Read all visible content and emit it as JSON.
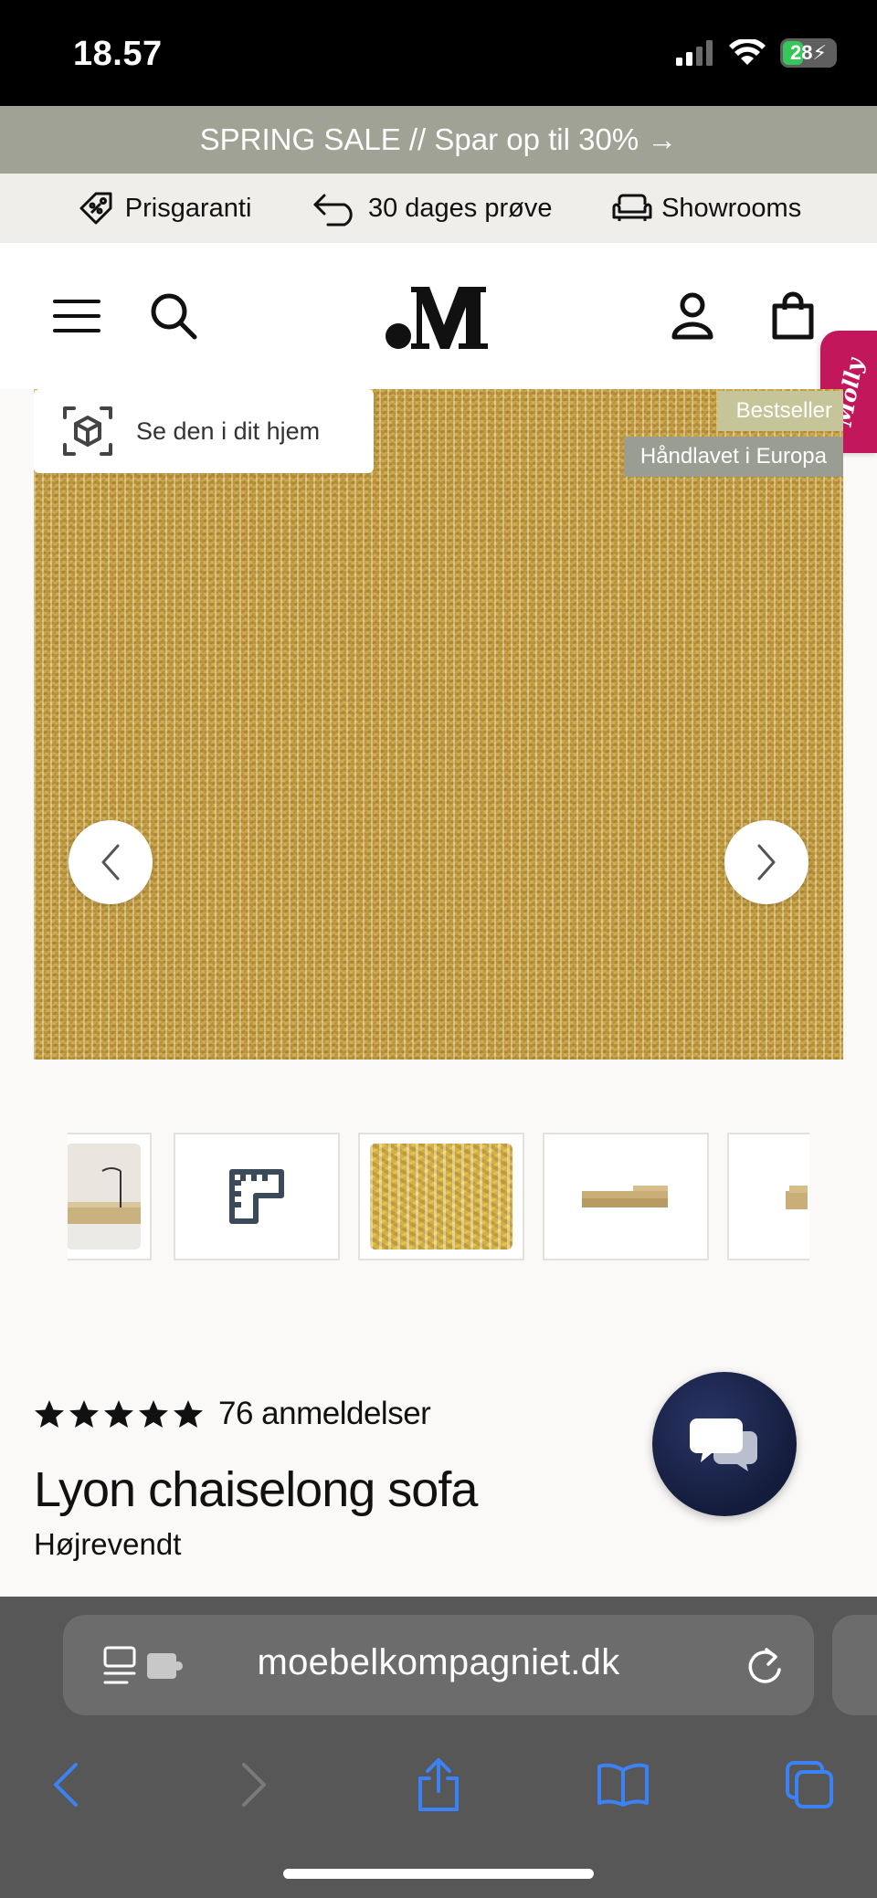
{
  "status_bar": {
    "time": "18.57",
    "battery": "28"
  },
  "sale_banner": {
    "text": "SPRING SALE // Spar op til 30% →"
  },
  "usps": [
    {
      "label": "Prisgaranti",
      "icon": "price-tag-icon"
    },
    {
      "label": "30 dages prøve",
      "icon": "return-arrow-icon"
    },
    {
      "label": "Showrooms",
      "icon": "sofa-icon"
    }
  ],
  "header": {
    "logo": ".M",
    "icons": [
      "menu-icon",
      "search-icon",
      "user-icon",
      "bag-icon"
    ],
    "molly_tab": "Molly"
  },
  "gallery": {
    "ar_button_label": "Se den i dit hjem",
    "badges": [
      "Bestseller",
      "Håndlavet i Europa"
    ],
    "prev": "chevron-left-icon",
    "next": "chevron-right-icon"
  },
  "thumbnails": [
    "room-photo",
    "dimensions-icon",
    "fabric-swatch",
    "sofa-side",
    "sofa-partial"
  ],
  "product": {
    "rating": 5,
    "review_count": "76 anmeldelser",
    "title": "Lyon chaiselong sofa",
    "variant": "Højrevendt"
  },
  "safari": {
    "url": "moebelkompagniet.dk",
    "toolbar": [
      "back",
      "forward",
      "share",
      "bookmarks",
      "tabs"
    ]
  },
  "colors": {
    "banner": "#9fa294",
    "chat": "#1c2550",
    "molly": "#c2185b",
    "safari_link": "#3b82f6"
  }
}
